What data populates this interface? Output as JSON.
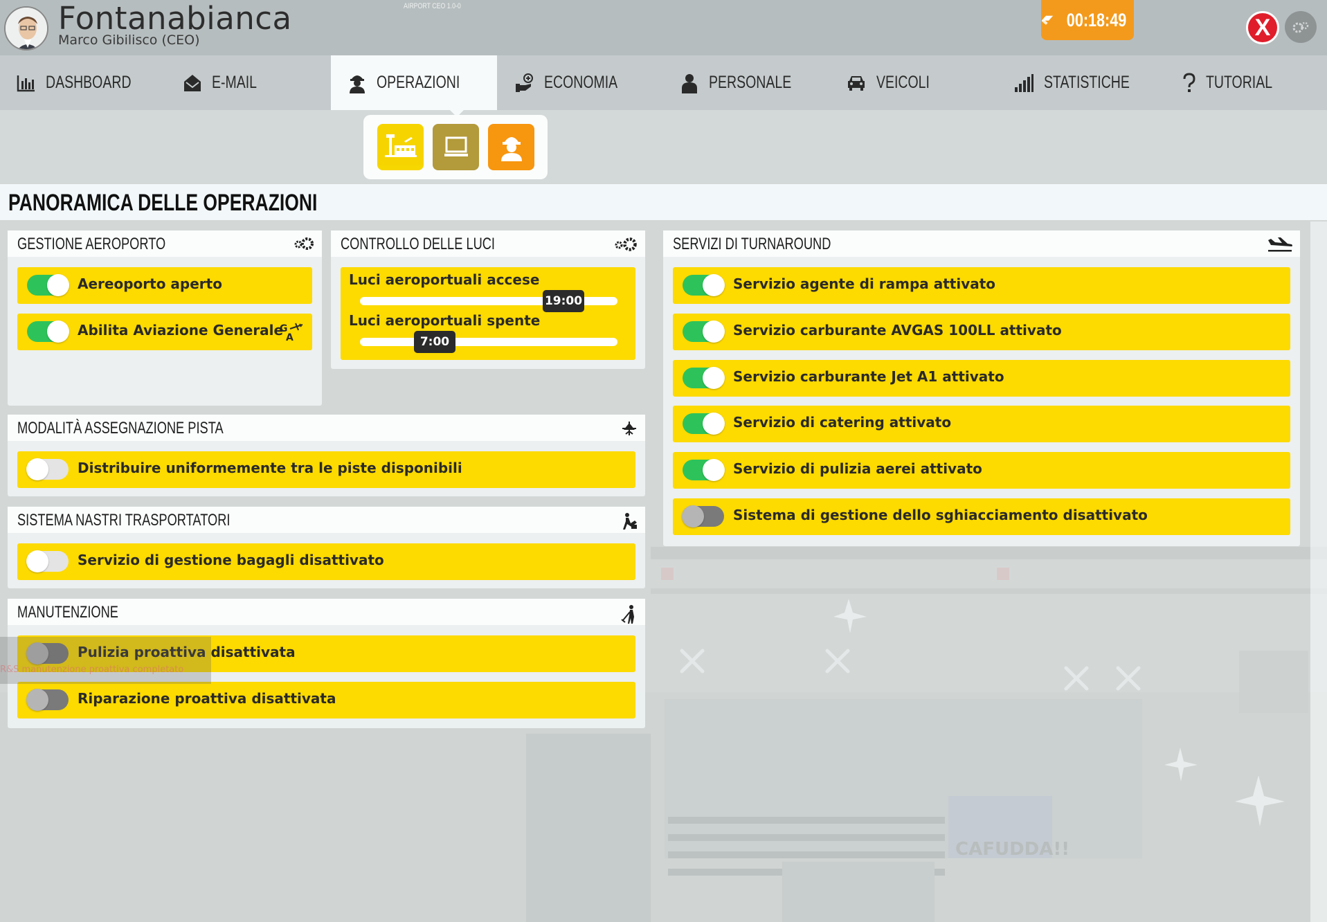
{
  "header": {
    "airport_name": "Fontanabianca",
    "ceo_name": "Marco Gibilisco (CEO)",
    "version": "AIRPORT CEO  1.0-0",
    "time": "00:18:49",
    "close_label": "X"
  },
  "tabs": [
    {
      "label": "DASHBOARD",
      "icon": "bar-chart-icon"
    },
    {
      "label": "E-MAIL",
      "icon": "envelope-icon"
    },
    {
      "label": "OPERAZIONI",
      "icon": "worker-icon",
      "active": true
    },
    {
      "label": "ECONOMIA",
      "icon": "money-icon"
    },
    {
      "label": "PERSONALE",
      "icon": "person-icon"
    },
    {
      "label": "VEICOLI",
      "icon": "car-icon"
    },
    {
      "label": "STATISTICHE",
      "icon": "signal-icon"
    },
    {
      "label": "TUTORIAL",
      "icon": "question-icon"
    }
  ],
  "subnav": [
    {
      "icon": "airport-icon",
      "color": "#f6d400",
      "active": true
    },
    {
      "icon": "computer-icon",
      "color": "#b39a3a"
    },
    {
      "icon": "worker-helmet-icon",
      "color": "#f7960f"
    }
  ],
  "page_title": "PANORAMICA DELLE OPERAZIONI",
  "panels": {
    "gestione": {
      "title": "GESTIONE AEROPORTO",
      "rows": [
        {
          "label": "Aereoporto aperto",
          "on": true
        },
        {
          "label": "Abilita Aviazione Generale",
          "on": true,
          "badge": "GA"
        }
      ]
    },
    "luci": {
      "title": "CONTROLLO DELLE LUCI",
      "on_label": "Luci aeroportuali accese",
      "on_time": "19:00",
      "on_value": 0.79,
      "off_label": "Luci aeroportuali spente",
      "off_time": "7:00",
      "off_value": 0.29
    },
    "pista": {
      "title": "MODALITÀ ASSEGNAZIONE PISTA",
      "rows": [
        {
          "label": "Distribuire uniformemente tra le piste disponibili",
          "on": false
        }
      ]
    },
    "nastri": {
      "title": "SISTEMA NASTRI TRASPORTATORI",
      "rows": [
        {
          "label": "Servizio di gestione bagagli disattivato",
          "on": false
        }
      ]
    },
    "manutenzione": {
      "title": "MANUTENZIONE",
      "rows": [
        {
          "label": "Pulizia proattiva disattivata",
          "on": false
        },
        {
          "label": "Riparazione proattiva disattivata",
          "on": false
        }
      ],
      "tooltip": "R&S manutenzione proattiva completato"
    },
    "turnaround": {
      "title": "SERVIZI DI TURNAROUND",
      "rows": [
        {
          "label": "Servizio agente di rampa attivato",
          "on": true
        },
        {
          "label": "Servizio carburante AVGAS 100LL attivato",
          "on": true
        },
        {
          "label": "Servizio carburante Jet A1 attivato",
          "on": true
        },
        {
          "label": "Servizio di catering attivato",
          "on": true
        },
        {
          "label": "Servizio di pulizia aerei attivato",
          "on": true
        },
        {
          "label": "Sistema di gestione dello sghiacciamento disattivato",
          "on": false
        }
      ]
    }
  },
  "map_text": "CAFUDDA!!"
}
